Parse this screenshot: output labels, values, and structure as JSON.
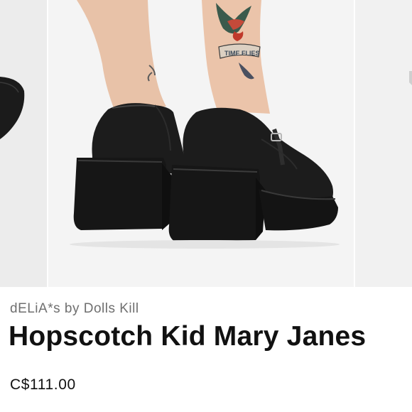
{
  "product": {
    "brand": "dELiA*s by Dolls Kill",
    "title": "Hopscotch Kid Mary Janes",
    "price": "C$111.00"
  },
  "gallery": {
    "current_image": "black platform mary jane heels worn by model with ankle tattoos",
    "tattoo_text": "TIME FLIES"
  },
  "colors": {
    "shoe": "#1a1a1a",
    "background": "#f4f4f4",
    "brand_text": "#6f6f6f",
    "title_text": "#111111"
  }
}
